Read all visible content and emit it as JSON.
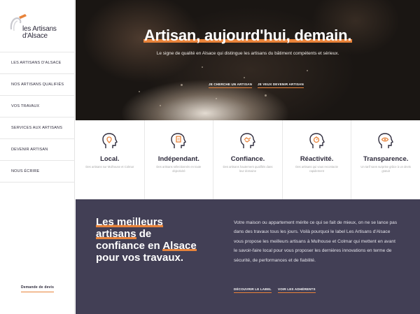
{
  "logo": {
    "line1": "les Artisans",
    "line2": "d'Alsace"
  },
  "nav": {
    "items": [
      "Les artisans d'Alsace",
      "Nos artisans qualifiés",
      "Vos travaux",
      "Services aux artisans",
      "Devenir artisan",
      "Nous écrire"
    ],
    "cta": "Demande de devis"
  },
  "hero": {
    "title": "Artisan, aujourd'hui, demain.",
    "subtitle": "Le signe de qualité en Alsace qui distingue les artisans du bâtiment compétents et sérieux.",
    "btn1": "Je cherche un artisan",
    "btn2": "Je veux devenir artisan"
  },
  "values": [
    {
      "title": "Local.",
      "desc": "Des artisans sur Mulhouse et Colmar",
      "icon": "location-head-icon"
    },
    {
      "title": "Indépendant.",
      "desc": "Des artisans sélectionnés en toute objectivité",
      "icon": "document-head-icon"
    },
    {
      "title": "Confiance.",
      "desc": "Des artisans hautement qualifiés dans leur domaine",
      "icon": "handshake-head-icon"
    },
    {
      "title": "Réactivité.",
      "desc": "Des artisans qui vous recontacte rapidement",
      "icon": "stopwatch-head-icon"
    },
    {
      "title": "Transparence.",
      "desc": "Un tarif sans surprise grâce à un devis gratuit",
      "icon": "eye-head-icon"
    }
  ],
  "bottom": {
    "title_l1": "Les meilleurs",
    "title_l2a": "artisans",
    "title_l2b": " de",
    "title_l3a": "confiance en ",
    "title_l3b": "Alsace",
    "title_l4": "pour vos travaux.",
    "text": "Votre maison ou appartement mérite ce qui se fait de mieux, on ne se lance pas dans des travaux tous les jours. Voilà pourquoi le label Les Artisans d'Alsace vous propose les meilleurs artisans à Mulhouse et Colmar qui mettent en avant le savoir-faire local pour vous proposer les dernières innovations en terme de sécurité, de performances et de fiabilité.",
    "btn1": "Découvrir le label",
    "btn2": "Voir les adhérents"
  },
  "colors": {
    "accent": "#e8833a",
    "dark": "#2d2a3b",
    "panel": "#423f55"
  }
}
